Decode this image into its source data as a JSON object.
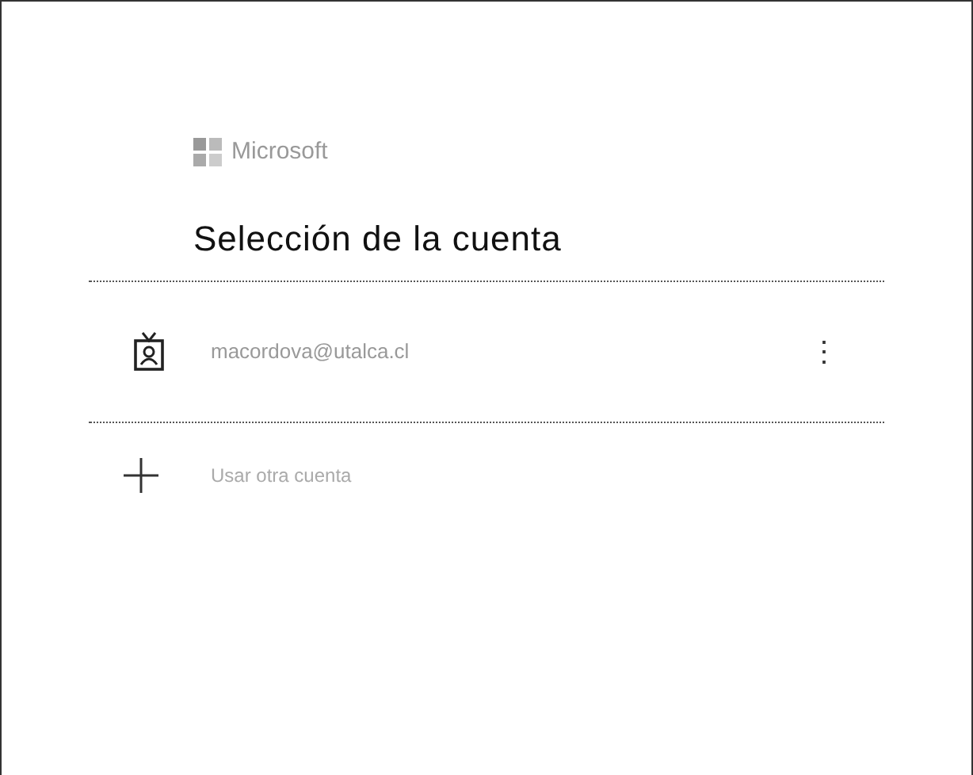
{
  "brand": "Microsoft",
  "title": "Selección de la cuenta",
  "accounts": [
    {
      "email": "macordova@utalca.cl",
      "menu": "⋮"
    }
  ],
  "add_account": "Usar otra cuenta"
}
